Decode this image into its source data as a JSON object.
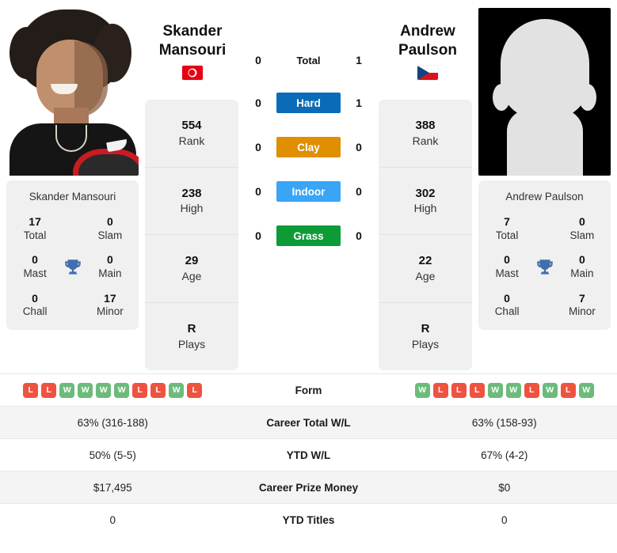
{
  "players": {
    "left": {
      "first_name": "Skander",
      "last_name": "Mansouri",
      "full_name": "Skander Mansouri",
      "flag": "tunisia-flag",
      "photo": "player-photo-left",
      "rank": "554",
      "rank_label": "Rank",
      "high": "238",
      "high_label": "High",
      "age": "29",
      "age_label": "Age",
      "plays": "R",
      "plays_label": "Plays",
      "titles": {
        "total": "17",
        "total_label": "Total",
        "slam": "0",
        "slam_label": "Slam",
        "mast": "0",
        "mast_label": "Mast",
        "main": "0",
        "main_label": "Main",
        "chall": "0",
        "chall_label": "Chall",
        "minor": "17",
        "minor_label": "Minor"
      },
      "form": [
        "L",
        "L",
        "W",
        "W",
        "W",
        "W",
        "L",
        "L",
        "W",
        "L"
      ],
      "career_total_wl": "63% (316-188)",
      "ytd_wl": "50% (5-5)",
      "career_prize_money": "$17,495",
      "ytd_titles": "0"
    },
    "right": {
      "first_name": "Andrew",
      "last_name": "Paulson",
      "full_name": "Andrew Paulson",
      "flag": "czech-republic-flag",
      "photo": "player-photo-right",
      "rank": "388",
      "rank_label": "Rank",
      "high": "302",
      "high_label": "High",
      "age": "22",
      "age_label": "Age",
      "plays": "R",
      "plays_label": "Plays",
      "titles": {
        "total": "7",
        "total_label": "Total",
        "slam": "0",
        "slam_label": "Slam",
        "mast": "0",
        "mast_label": "Mast",
        "main": "0",
        "main_label": "Main",
        "chall": "0",
        "chall_label": "Chall",
        "minor": "7",
        "minor_label": "Minor"
      },
      "form": [
        "W",
        "L",
        "L",
        "L",
        "W",
        "W",
        "L",
        "W",
        "L",
        "W"
      ],
      "career_total_wl": "63% (158-93)",
      "ytd_wl": "67% (4-2)",
      "career_prize_money": "$0",
      "ytd_titles": "0"
    }
  },
  "h2h": [
    {
      "label": "Total",
      "left": "0",
      "right": "1",
      "color": "",
      "style": "plain"
    },
    {
      "label": "Hard",
      "left": "0",
      "right": "1",
      "color": "#0a6cb8",
      "style": "pill"
    },
    {
      "label": "Clay",
      "left": "0",
      "right": "0",
      "color": "#df8f00",
      "style": "pill"
    },
    {
      "label": "Indoor",
      "left": "0",
      "right": "0",
      "color": "#39a5f7",
      "style": "pill"
    },
    {
      "label": "Grass",
      "left": "0",
      "right": "0",
      "color": "#0c9b36",
      "style": "pill"
    }
  ],
  "table": [
    {
      "label": "Form",
      "left": "",
      "right": "",
      "type": "form",
      "alt": false
    },
    {
      "label": "Career Total W/L",
      "left": "63% (316-188)",
      "right": "63% (158-93)",
      "type": "text",
      "alt": true
    },
    {
      "label": "YTD W/L",
      "left": "50% (5-5)",
      "right": "67% (4-2)",
      "type": "text",
      "alt": false
    },
    {
      "label": "Career Prize Money",
      "left": "$17,495",
      "right": "$0",
      "type": "text",
      "alt": true
    },
    {
      "label": "YTD Titles",
      "left": "0",
      "right": "0",
      "type": "text",
      "alt": false
    }
  ],
  "colors": {
    "win": "#6cbb7b",
    "loss": "#ef5340",
    "hard": "#0a6cb8",
    "clay": "#df8f00",
    "indoor": "#39a5f7",
    "grass": "#0c9b36",
    "card_bg": "#f0f0f0",
    "row_alt": "#f4f4f4"
  }
}
